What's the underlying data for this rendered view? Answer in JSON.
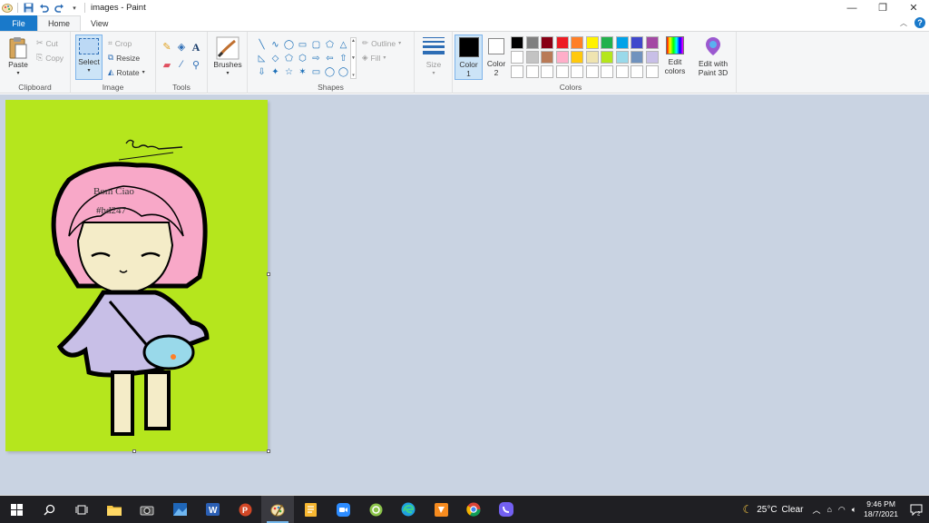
{
  "window": {
    "title": "images - Paint",
    "controls": [
      "minimize-icon",
      "restore-icon",
      "close-icon"
    ]
  },
  "tabs": [
    {
      "label": "File"
    },
    {
      "label": "Home"
    },
    {
      "label": "View"
    }
  ],
  "clipboard": {
    "paste_label": "Paste",
    "cut_label": "Cut",
    "copy_label": "Copy",
    "group_label": "Clipboard"
  },
  "image": {
    "select_label": "Select",
    "crop_label": "Crop",
    "resize_label": "Resize",
    "rotate_label": "Rotate",
    "group_label": "Image"
  },
  "tools": {
    "group_label": "Tools",
    "items": [
      "pencil-icon",
      "fill-icon",
      "text-icon",
      "eraser-icon",
      "color-picker-icon",
      "magnifier-icon"
    ]
  },
  "brushes": {
    "label": "Brushes"
  },
  "shapes": {
    "group_label": "Shapes",
    "outline_label": "Outline",
    "fill_label": "Fill",
    "glyphs": [
      "╲",
      "∿",
      "◯",
      "▭",
      "▢",
      "⬠",
      "△",
      "◺",
      "◇",
      "⬠",
      "⬡",
      "⇨",
      "⇦",
      "⇧",
      "⇩",
      "✦",
      "☆",
      "✶",
      "▭",
      "◯",
      "◯"
    ]
  },
  "size": {
    "label": "Size"
  },
  "colors": {
    "group_label": "Colors",
    "color1_label": "Color",
    "color1_num": "1",
    "color2_label": "Color",
    "color2_num": "2",
    "color1_value": "#000000",
    "color2_value": "#ffffff",
    "edit_colors_label1": "Edit",
    "edit_colors_label2": "colors",
    "paint3d_label1": "Edit with",
    "paint3d_label2": "Paint 3D",
    "palette": [
      "#000000",
      "#7f7f7f",
      "#880015",
      "#ed1c24",
      "#ff7f27",
      "#fff200",
      "#22b14c",
      "#00a2e8",
      "#3f48cc",
      "#a349a4",
      "#ffffff",
      "#c3c3c3",
      "#b97a57",
      "#ffaec9",
      "#ffc90e",
      "#efe4b0",
      "#b5e61d",
      "#99d9ea",
      "#7092be",
      "#c8bfe7",
      "#ffffff",
      "#ffffff",
      "#ffffff",
      "#ffffff",
      "#ffffff",
      "#ffffff",
      "#ffffff",
      "#ffffff",
      "#ffffff",
      "#ffffff"
    ]
  },
  "canvas": {
    "background": "#b5e61d",
    "drawing_text1": "Bom Ciao",
    "drawing_text2": "#hd247"
  },
  "taskbar": {
    "apps": [
      "windows-start-icon",
      "search-icon",
      "task-view-icon",
      "file-explorer-icon",
      "camera-icon",
      "photos-icon",
      "word-icon",
      "powerpoint-icon",
      "paint-icon",
      "notes-icon",
      "zoom-icon",
      "app-icon",
      "edge-icon",
      "app-orange-icon",
      "chrome-icon",
      "viber-icon"
    ],
    "weather_temp": "25°C",
    "weather_desc": "Clear",
    "time": "9:46 PM",
    "date": "18/7/2021"
  }
}
